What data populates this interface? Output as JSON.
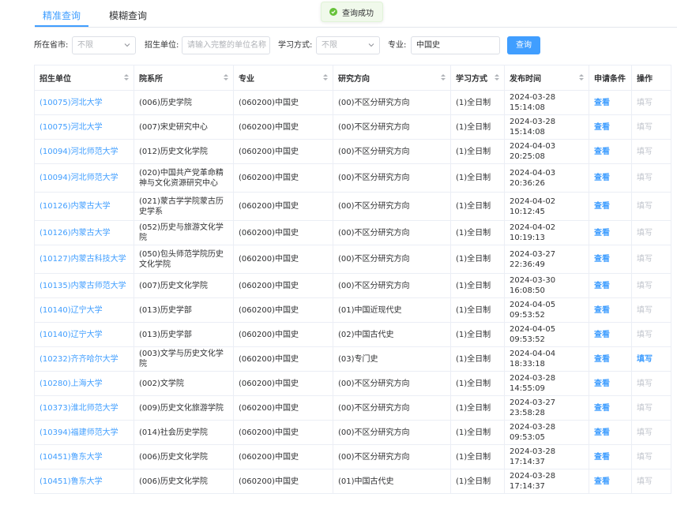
{
  "tabs": [
    {
      "label": "精准查询",
      "active": true
    },
    {
      "label": "模糊查询",
      "active": false
    }
  ],
  "toast": {
    "text": "查询成功"
  },
  "filters": {
    "province_label": "所在省市:",
    "province_value": "不限",
    "unit_label": "招生单位:",
    "unit_placeholder": "请输入完整的单位名称",
    "mode_label": "学习方式:",
    "mode_value": "不限",
    "major_label": "专业:",
    "major_value": "中国史",
    "search_button": "查询"
  },
  "table": {
    "headers": [
      "招生单位",
      "院系所",
      "专业",
      "研究方向",
      "学习方式",
      "发布时间",
      "申请条件",
      "操作"
    ],
    "rows": [
      {
        "unit": "(10075)河北大学",
        "dept": "(006)历史学院",
        "major": "(060200)中国史",
        "direction": "(00)不区分研究方向",
        "mode": "(1)全日制",
        "time": "2024-03-28 15:14:08",
        "cond": "查看",
        "op": "填写",
        "op_active": false
      },
      {
        "unit": "(10075)河北大学",
        "dept": "(007)宋史研究中心",
        "major": "(060200)中国史",
        "direction": "(00)不区分研究方向",
        "mode": "(1)全日制",
        "time": "2024-03-28 15:14:08",
        "cond": "查看",
        "op": "填写",
        "op_active": false
      },
      {
        "unit": "(10094)河北师范大学",
        "dept": "(012)历史文化学院",
        "major": "(060200)中国史",
        "direction": "(00)不区分研究方向",
        "mode": "(1)全日制",
        "time": "2024-04-03 20:25:08",
        "cond": "查看",
        "op": "填写",
        "op_active": false
      },
      {
        "unit": "(10094)河北师范大学",
        "dept": "(020)中国共产党革命精神与文化资源研究中心",
        "major": "(060200)中国史",
        "direction": "(00)不区分研究方向",
        "mode": "(1)全日制",
        "time": "2024-04-03 20:36:26",
        "cond": "查看",
        "op": "填写",
        "op_active": false,
        "tall": true
      },
      {
        "unit": "(10126)内蒙古大学",
        "dept": "(021)蒙古学学院蒙古历史学系",
        "major": "(060200)中国史",
        "direction": "(00)不区分研究方向",
        "mode": "(1)全日制",
        "time": "2024-04-02 10:12:45",
        "cond": "查看",
        "op": "填写",
        "op_active": false,
        "tall": true
      },
      {
        "unit": "(10126)内蒙古大学",
        "dept": "(052)历史与旅游文化学院",
        "major": "(060200)中国史",
        "direction": "(00)不区分研究方向",
        "mode": "(1)全日制",
        "time": "2024-04-02 10:19:13",
        "cond": "查看",
        "op": "填写",
        "op_active": false
      },
      {
        "unit": "(10127)内蒙古科技大学",
        "dept": "(050)包头师范学院历史文化学院",
        "major": "(060200)中国史",
        "direction": "(00)不区分研究方向",
        "mode": "(1)全日制",
        "time": "2024-03-27 22:36:49",
        "cond": "查看",
        "op": "填写",
        "op_active": false,
        "tall": true
      },
      {
        "unit": "(10135)内蒙古师范大学",
        "dept": "(007)历史文化学院",
        "major": "(060200)中国史",
        "direction": "(00)不区分研究方向",
        "mode": "(1)全日制",
        "time": "2024-03-30 16:08:50",
        "cond": "查看",
        "op": "填写",
        "op_active": false
      },
      {
        "unit": "(10140)辽宁大学",
        "dept": "(013)历史学部",
        "major": "(060200)中国史",
        "direction": "(01)中国近现代史",
        "mode": "(1)全日制",
        "time": "2024-04-05 09:53:52",
        "cond": "查看",
        "op": "填写",
        "op_active": false
      },
      {
        "unit": "(10140)辽宁大学",
        "dept": "(013)历史学部",
        "major": "(060200)中国史",
        "direction": "(02)中国古代史",
        "mode": "(1)全日制",
        "time": "2024-04-05 09:53:52",
        "cond": "查看",
        "op": "填写",
        "op_active": false
      },
      {
        "unit": "(10232)齐齐哈尔大学",
        "dept": "(003)文学与历史文化学院",
        "major": "(060200)中国史",
        "direction": "(03)专门史",
        "mode": "(1)全日制",
        "time": "2024-04-04 18:33:18",
        "cond": "查看",
        "op": "填写",
        "op_active": true
      },
      {
        "unit": "(10280)上海大学",
        "dept": "(002)文学院",
        "major": "(060200)中国史",
        "direction": "(00)不区分研究方向",
        "mode": "(1)全日制",
        "time": "2024-03-28 14:55:09",
        "cond": "查看",
        "op": "填写",
        "op_active": false
      },
      {
        "unit": "(10373)淮北师范大学",
        "dept": "(009)历史文化旅游学院",
        "major": "(060200)中国史",
        "direction": "(00)不区分研究方向",
        "mode": "(1)全日制",
        "time": "2024-03-27 23:58:28",
        "cond": "查看",
        "op": "填写",
        "op_active": false
      },
      {
        "unit": "(10394)福建师范大学",
        "dept": "(014)社会历史学院",
        "major": "(060200)中国史",
        "direction": "(00)不区分研究方向",
        "mode": "(1)全日制",
        "time": "2024-03-28 09:53:05",
        "cond": "查看",
        "op": "填写",
        "op_active": false
      },
      {
        "unit": "(10451)鲁东大学",
        "dept": "(006)历史文化学院",
        "major": "(060200)中国史",
        "direction": "(00)不区分研究方向",
        "mode": "(1)全日制",
        "time": "2024-03-28 17:14:37",
        "cond": "查看",
        "op": "填写",
        "op_active": false
      },
      {
        "unit": "(10451)鲁东大学",
        "dept": "(006)历史文化学院",
        "major": "(060200)中国史",
        "direction": "(01)中国古代史",
        "mode": "(1)全日制",
        "time": "2024-03-28 17:14:37",
        "cond": "查看",
        "op": "填写",
        "op_active": false
      }
    ]
  },
  "colors": {
    "accent": "#409eff",
    "success": "#67c23a",
    "disabled_link": "#c0c4cc",
    "border": "#ebeef5"
  },
  "icons": {
    "toast": "check-circle-icon",
    "select": "chevron-down-icon",
    "sort": "sort-caret-icon"
  }
}
